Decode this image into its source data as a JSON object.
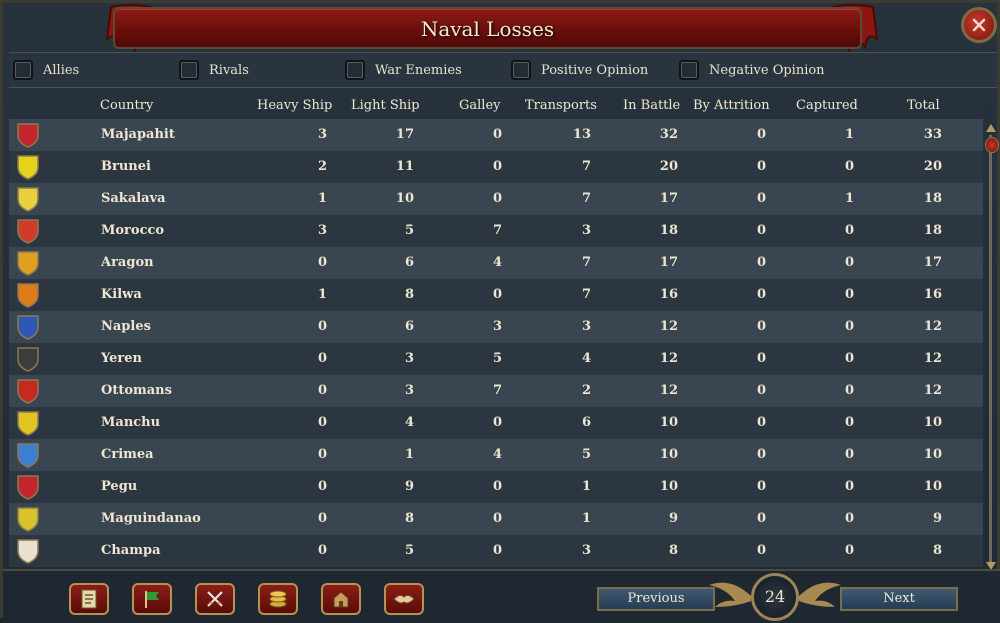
{
  "window": {
    "title": "Naval Losses"
  },
  "filters": [
    {
      "label": "Allies"
    },
    {
      "label": "Rivals"
    },
    {
      "label": "War Enemies"
    },
    {
      "label": "Positive Opinion"
    },
    {
      "label": "Negative Opinion"
    }
  ],
  "table": {
    "columns": [
      "Country",
      "Heavy Ship",
      "Light Ship",
      "Galley",
      "Transports",
      "In Battle",
      "By Attrition",
      "Captured",
      "Total"
    ],
    "rows": [
      {
        "country": "Majapahit",
        "heavy": "3",
        "light": "17",
        "galley": "0",
        "transports": "13",
        "battle": "32",
        "attrition": "0",
        "captured": "1",
        "total": "33",
        "shield_color": "#c2252a"
      },
      {
        "country": "Brunei",
        "heavy": "2",
        "light": "11",
        "galley": "0",
        "transports": "7",
        "battle": "20",
        "attrition": "0",
        "captured": "0",
        "total": "20",
        "shield_color": "#e4d21b"
      },
      {
        "country": "Sakalava",
        "heavy": "1",
        "light": "10",
        "galley": "0",
        "transports": "7",
        "battle": "17",
        "attrition": "0",
        "captured": "1",
        "total": "18",
        "shield_color": "#e8cf3c"
      },
      {
        "country": "Morocco",
        "heavy": "3",
        "light": "5",
        "galley": "7",
        "transports": "3",
        "battle": "18",
        "attrition": "0",
        "captured": "0",
        "total": "18",
        "shield_color": "#d23a2a"
      },
      {
        "country": "Aragon",
        "heavy": "0",
        "light": "6",
        "galley": "4",
        "transports": "7",
        "battle": "17",
        "attrition": "0",
        "captured": "0",
        "total": "17",
        "shield_color": "#e0a020"
      },
      {
        "country": "Kilwa",
        "heavy": "1",
        "light": "8",
        "galley": "0",
        "transports": "7",
        "battle": "16",
        "attrition": "0",
        "captured": "0",
        "total": "16",
        "shield_color": "#e07b1a"
      },
      {
        "country": "Naples",
        "heavy": "0",
        "light": "6",
        "galley": "3",
        "transports": "3",
        "battle": "12",
        "attrition": "0",
        "captured": "0",
        "total": "12",
        "shield_color": "#2e58b8"
      },
      {
        "country": "Yeren",
        "heavy": "0",
        "light": "3",
        "galley": "5",
        "transports": "4",
        "battle": "12",
        "attrition": "0",
        "captured": "0",
        "total": "12",
        "shield_color": "#3c3c3c"
      },
      {
        "country": "Ottomans",
        "heavy": "0",
        "light": "3",
        "galley": "7",
        "transports": "2",
        "battle": "12",
        "attrition": "0",
        "captured": "0",
        "total": "12",
        "shield_color": "#c42a20"
      },
      {
        "country": "Manchu",
        "heavy": "0",
        "light": "4",
        "galley": "0",
        "transports": "6",
        "battle": "10",
        "attrition": "0",
        "captured": "0",
        "total": "10",
        "shield_color": "#e3c51f"
      },
      {
        "country": "Crimea",
        "heavy": "0",
        "light": "1",
        "galley": "4",
        "transports": "5",
        "battle": "10",
        "attrition": "0",
        "captured": "0",
        "total": "10",
        "shield_color": "#3d7fd0"
      },
      {
        "country": "Pegu",
        "heavy": "0",
        "light": "9",
        "galley": "0",
        "transports": "1",
        "battle": "10",
        "attrition": "0",
        "captured": "0",
        "total": "10",
        "shield_color": "#c2252a"
      },
      {
        "country": "Maguindanao",
        "heavy": "0",
        "light": "8",
        "galley": "0",
        "transports": "1",
        "battle": "9",
        "attrition": "0",
        "captured": "0",
        "total": "9",
        "shield_color": "#d8c32a"
      },
      {
        "country": "Champa",
        "heavy": "0",
        "light": "5",
        "galley": "0",
        "transports": "3",
        "battle": "8",
        "attrition": "0",
        "captured": "0",
        "total": "8",
        "shield_color": "#e9e0cf"
      }
    ]
  },
  "bottom": {
    "tools": [
      "ledger-icon",
      "flag-icon",
      "crossed-swords-icon",
      "coins-icon",
      "buildings-icon",
      "handshake-icon"
    ],
    "previous_label": "Previous",
    "next_label": "Next",
    "page": "24"
  }
}
